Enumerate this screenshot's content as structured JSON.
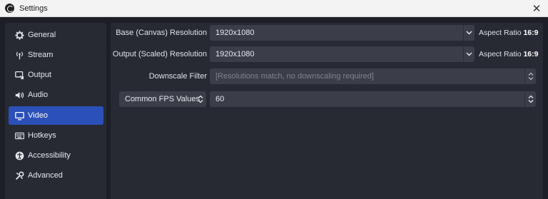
{
  "window": {
    "title": "Settings",
    "close_glyph": "✕"
  },
  "sidebar": {
    "items": [
      {
        "label": "General",
        "icon": "gear-icon"
      },
      {
        "label": "Stream",
        "icon": "antenna-icon"
      },
      {
        "label": "Output",
        "icon": "output-icon"
      },
      {
        "label": "Audio",
        "icon": "speaker-icon"
      },
      {
        "label": "Video",
        "icon": "monitor-icon",
        "active": true
      },
      {
        "label": "Hotkeys",
        "icon": "keyboard-icon"
      },
      {
        "label": "Accessibility",
        "icon": "accessibility-icon"
      },
      {
        "label": "Advanced",
        "icon": "wrench-icon"
      }
    ]
  },
  "video": {
    "base_resolution": {
      "label": "Base (Canvas) Resolution",
      "value": "1920x1080",
      "aspect_prefix": "Aspect Ratio",
      "aspect_value": "16:9"
    },
    "output_resolution": {
      "label": "Output (Scaled) Resolution",
      "value": "1920x1080",
      "aspect_prefix": "Aspect Ratio",
      "aspect_value": "16:9"
    },
    "downscale_filter": {
      "label": "Downscale Filter",
      "value": "[Resolutions match, no downscaling required]"
    },
    "fps": {
      "type_label": "Common FPS Values",
      "value": "60"
    }
  },
  "colors": {
    "accent": "#2b50b8",
    "panel": "#272a33",
    "background": "#1d1f26",
    "field": "#3b3e48"
  }
}
